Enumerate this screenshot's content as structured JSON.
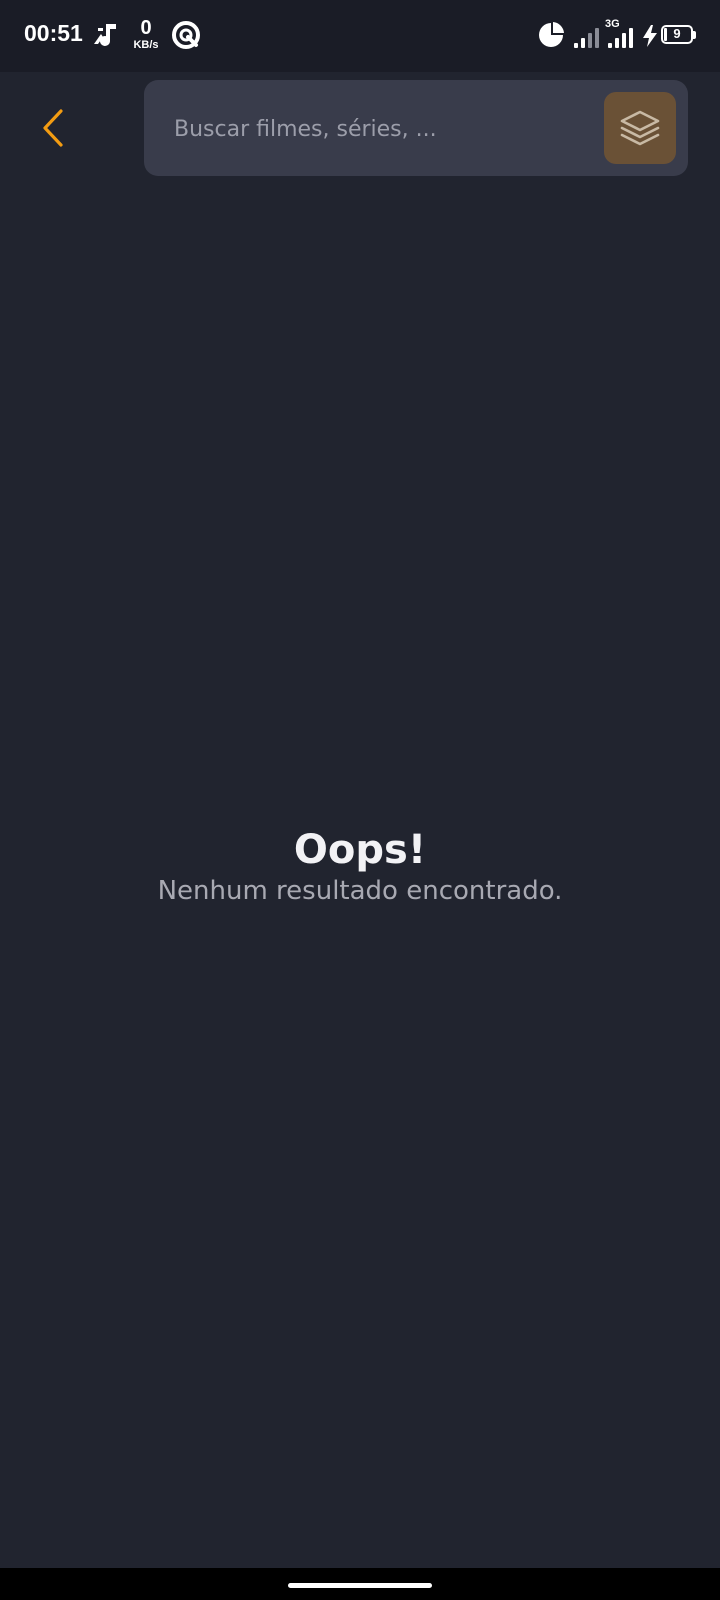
{
  "status_bar": {
    "time": "00:51",
    "net_speed_value": "0",
    "net_speed_unit": "KB/s",
    "network_type": "3G",
    "battery_level": "9",
    "icons": [
      "music-note-icon",
      "media-app-icon",
      "data-usage-icon",
      "signal-sim1-icon",
      "signal-sim2-icon",
      "charging-bolt-icon",
      "battery-icon"
    ]
  },
  "header": {
    "back_icon": "chevron-left-icon",
    "search_placeholder": "Buscar filmes, séries, ...",
    "search_value": "",
    "filter_icon": "layers-icon"
  },
  "empty_state": {
    "title": "Oops!",
    "message": "Nenhum resultado encontrado."
  },
  "colors": {
    "background": "#21242f",
    "status_bar": "#1a1c26",
    "search_bg": "#393c4b",
    "accent": "#f39c12",
    "filter_button_bg": "#6a5136"
  }
}
